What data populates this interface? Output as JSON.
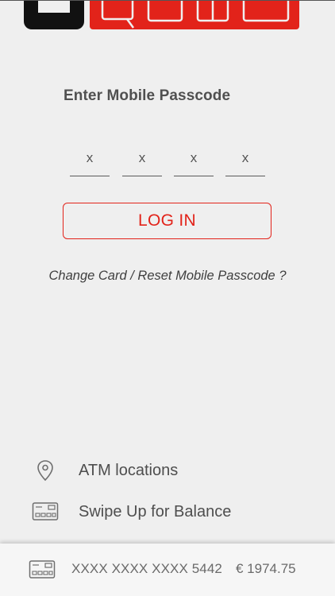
{
  "brand": {
    "primary_color": "#e2231a",
    "dark_color": "#111111"
  },
  "login": {
    "title": "Enter Mobile Passcode",
    "pin_placeholders": [
      "x",
      "x",
      "x",
      "x"
    ],
    "login_button": "LOG IN",
    "reset_link": "Change Card / Reset Mobile Passcode ?"
  },
  "links": {
    "atm": {
      "label": "ATM locations",
      "icon": "map-pin-icon"
    },
    "swipe": {
      "label": "Swipe Up for Balance",
      "icon": "card-icon"
    }
  },
  "account": {
    "card_number": "XXXX XXXX XXXX 5442",
    "balance": "€ 1974.75",
    "icon": "card-icon"
  }
}
